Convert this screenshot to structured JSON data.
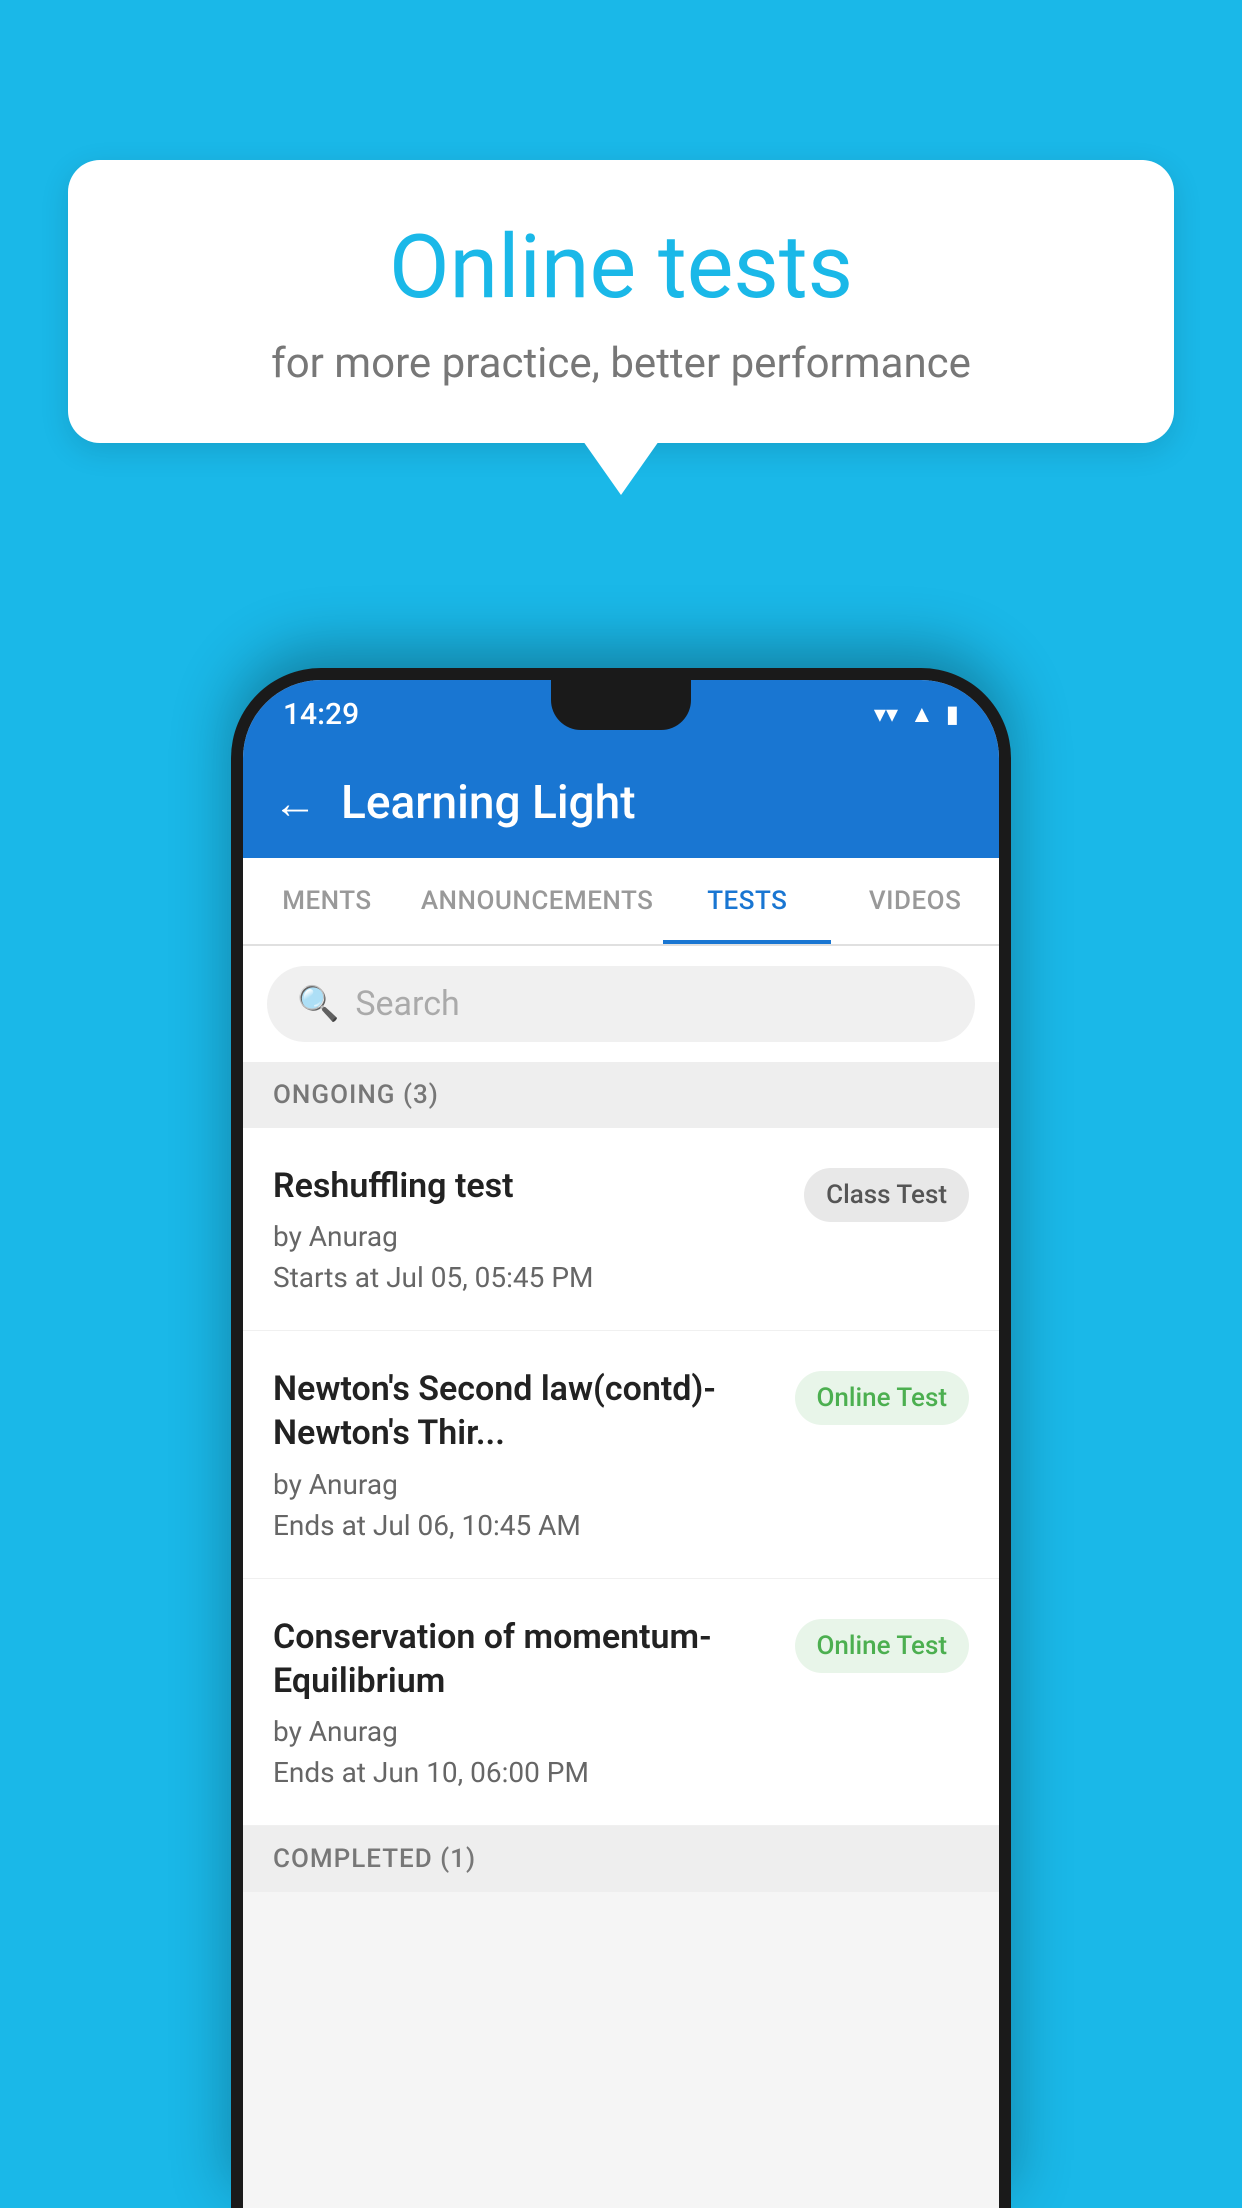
{
  "background": {
    "color": "#1ab8e8"
  },
  "bubble": {
    "title": "Online tests",
    "subtitle": "for more practice, better performance"
  },
  "phone": {
    "status_bar": {
      "time": "14:29",
      "icons": [
        "wifi",
        "signal",
        "battery"
      ]
    },
    "app_bar": {
      "title": "Learning Light",
      "back_label": "←"
    },
    "tabs": [
      {
        "label": "MENTS",
        "active": false
      },
      {
        "label": "ANNOUNCEMENTS",
        "active": false
      },
      {
        "label": "TESTS",
        "active": true
      },
      {
        "label": "VIDEOS",
        "active": false
      }
    ],
    "search": {
      "placeholder": "Search",
      "icon": "🔍"
    },
    "ongoing_section": {
      "label": "ONGOING (3)",
      "items": [
        {
          "name": "Reshuffling test",
          "by": "by Anurag",
          "date": "Starts at  Jul 05, 05:45 PM",
          "badge": "Class Test",
          "badge_type": "class"
        },
        {
          "name": "Newton's Second law(contd)-Newton's Thir...",
          "by": "by Anurag",
          "date": "Ends at  Jul 06, 10:45 AM",
          "badge": "Online Test",
          "badge_type": "online"
        },
        {
          "name": "Conservation of momentum-Equilibrium",
          "by": "by Anurag",
          "date": "Ends at  Jun 10, 06:00 PM",
          "badge": "Online Test",
          "badge_type": "online"
        }
      ]
    },
    "completed_section": {
      "label": "COMPLETED (1)"
    }
  }
}
